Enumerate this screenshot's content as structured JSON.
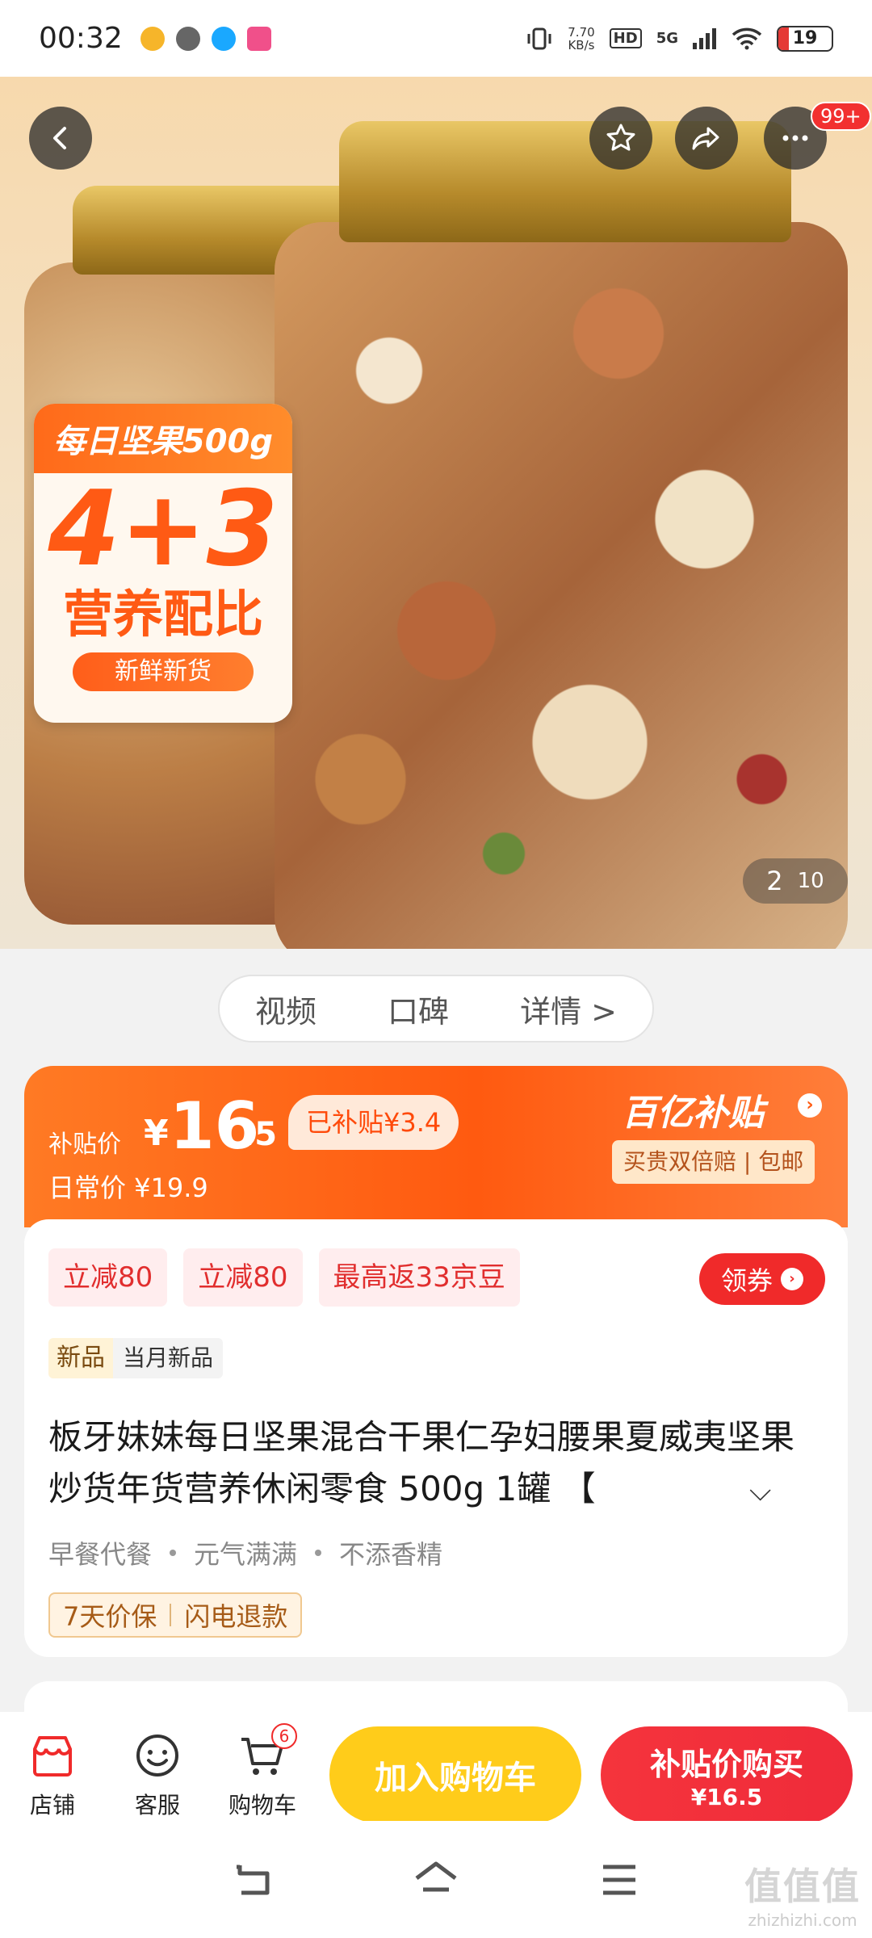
{
  "status_bar": {
    "time": "00:32",
    "net_speed_value": "7.70",
    "net_speed_unit": "KB/s",
    "hd_label": "HD",
    "network": "5G",
    "battery": "19"
  },
  "hero": {
    "promo_head": "每日坚果500g",
    "promo_big": "4+3",
    "promo_mid": "营养配比",
    "promo_pill": "新鲜新货",
    "more_badge": "99+",
    "page_current": "2",
    "page_total": "10"
  },
  "tabs": [
    "视频",
    "口碑",
    "详情 >"
  ],
  "price": {
    "label": "补贴价",
    "yen": "¥",
    "value_int": "16",
    "value_dec": ".5",
    "subsidy": "已补贴¥3.4",
    "daily_price": "日常价 ¥19.9",
    "brand": "百亿补贴",
    "guarantee": "买贵双倍赔 | 包邮",
    "colors": {
      "accent": "#ff5a10",
      "red": "#f02a2a",
      "yellow": "#ffcc1a"
    }
  },
  "info": {
    "coupons": [
      "立减80",
      "立减80",
      "最高返33京豆"
    ],
    "coupon_button": "领券",
    "new_tag": "新品",
    "new_tag_text": "当月新品",
    "title": "板牙妹妹每日坚果混合干果仁孕妇腰果夏威夷坚果炒货年货营养休闲零食 500g 1罐 【",
    "features": [
      "早餐代餐",
      "元气满满",
      "不添香精"
    ],
    "guards": [
      "7天价保",
      "闪电退款"
    ]
  },
  "bottom_bar": {
    "store": "店铺",
    "service": "客服",
    "cart": "购物车",
    "cart_count": "6",
    "add_to_cart": "加入购物车",
    "buy_line1": "补贴价购买",
    "buy_line2": "¥16.5"
  },
  "watermark": {
    "text": "值值值",
    "site": "zhizhizhi.com"
  }
}
